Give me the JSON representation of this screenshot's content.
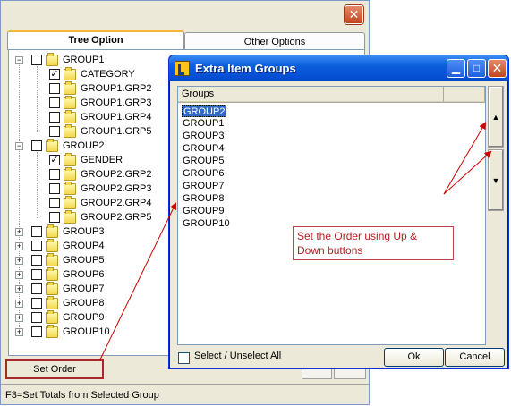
{
  "main_window": {
    "tabs": [
      {
        "label": "Tree Option"
      },
      {
        "label": "Other Options"
      }
    ],
    "tree": [
      {
        "label": "GROUP1",
        "checked": false,
        "children": [
          {
            "label": "CATEGORY",
            "checked": true
          },
          {
            "label": "GROUP1.GRP2",
            "checked": false
          },
          {
            "label": "GROUP1.GRP3",
            "checked": false
          },
          {
            "label": "GROUP1.GRP4",
            "checked": false
          },
          {
            "label": "GROUP1.GRP5",
            "checked": false
          }
        ]
      },
      {
        "label": "GROUP2",
        "checked": false,
        "children": [
          {
            "label": "GENDER",
            "checked": true
          },
          {
            "label": "GROUP2.GRP2",
            "checked": false
          },
          {
            "label": "GROUP2.GRP3",
            "checked": false
          },
          {
            "label": "GROUP2.GRP4",
            "checked": false
          },
          {
            "label": "GROUP2.GRP5",
            "checked": false
          }
        ]
      },
      {
        "label": "GROUP3",
        "checked": false
      },
      {
        "label": "GROUP4",
        "checked": false
      },
      {
        "label": "GROUP5",
        "checked": false
      },
      {
        "label": "GROUP6",
        "checked": false
      },
      {
        "label": "GROUP7",
        "checked": false
      },
      {
        "label": "GROUP8",
        "checked": false
      },
      {
        "label": "GROUP9",
        "checked": false
      },
      {
        "label": "GROUP10",
        "checked": false
      }
    ],
    "set_order_label": "Set Order",
    "status_text": "F3=Set Totals from Selected Group",
    "close_glyph": "✕"
  },
  "dialog": {
    "title": "Extra Item Groups",
    "list_header": "Groups",
    "items": [
      "GROUP2",
      "GROUP1",
      "GROUP3",
      "GROUP4",
      "GROUP5",
      "GROUP6",
      "GROUP7",
      "GROUP8",
      "GROUP9",
      "GROUP10"
    ],
    "selected_item": "GROUP2",
    "select_all_label": "Select / Unselect All",
    "ok_label": "Ok",
    "cancel_label": "Cancel",
    "minimize_glyph": "▁",
    "maximize_glyph": "□",
    "close_glyph": "✕",
    "up_glyph": "▲",
    "down_glyph": "▼"
  },
  "annotation": {
    "line1": "Set the Order using Up &",
    "line2": "Down buttons",
    "color": "#cc0000"
  },
  "colors": {
    "title_blue": "#0a5fdc",
    "selection": "#316ac5",
    "highlight_border": "#a52a2a"
  }
}
